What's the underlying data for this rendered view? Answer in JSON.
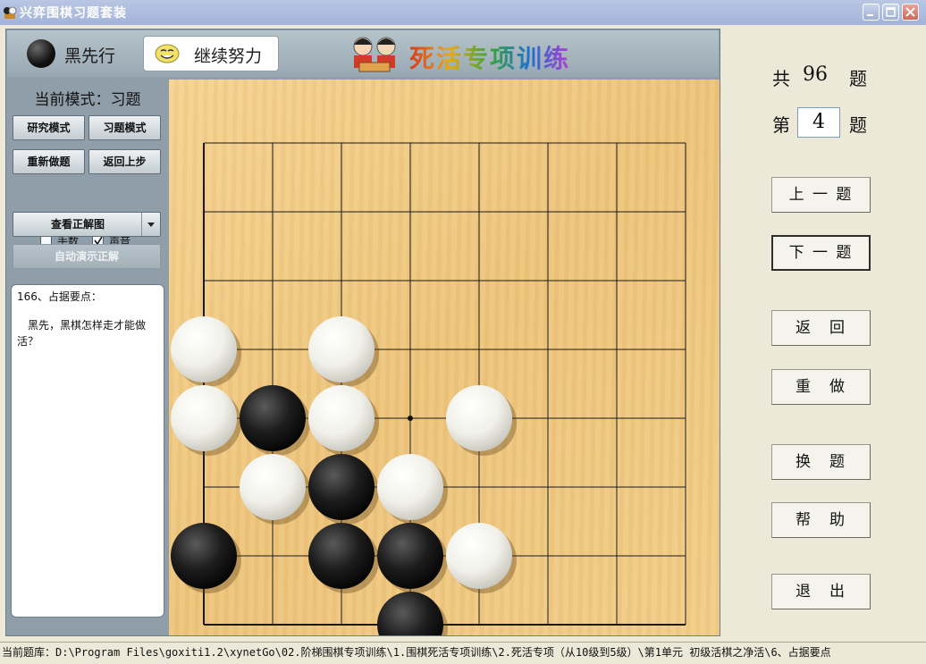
{
  "window": {
    "title": "兴弈围棋习题套装"
  },
  "header": {
    "turn_label": "黑先行",
    "message": "继续努力",
    "banner_title": "死活专项训练"
  },
  "sidebar": {
    "mode_label": "当前模式：习题",
    "buttons": {
      "study_mode": "研究模式",
      "exercise_mode": "习题模式",
      "redo": "重新做题",
      "undo": "返回上步"
    },
    "checkboxes": {
      "move_numbers": {
        "label": "手数",
        "checked": false
      },
      "sound": {
        "label": "声音",
        "checked": true
      }
    },
    "view_solution": "查看正解图",
    "auto_demo": "自动演示正解",
    "problem_title": "166、占据要点：",
    "problem_desc": "黑先，黑棋怎样走才能做活？"
  },
  "board": {
    "columns": 8,
    "rows": 8,
    "star_point": [
      3,
      4
    ],
    "stones": [
      {
        "color": "white",
        "col": 0,
        "row": 3
      },
      {
        "color": "white",
        "col": 2,
        "row": 3
      },
      {
        "color": "white",
        "col": 0,
        "row": 4
      },
      {
        "color": "black",
        "col": 1,
        "row": 4
      },
      {
        "color": "white",
        "col": 2,
        "row": 4
      },
      {
        "color": "white",
        "col": 4,
        "row": 4
      },
      {
        "color": "white",
        "col": 1,
        "row": 5
      },
      {
        "color": "black",
        "col": 2,
        "row": 5
      },
      {
        "color": "white",
        "col": 3,
        "row": 5
      },
      {
        "color": "black",
        "col": 0,
        "row": 6
      },
      {
        "color": "black",
        "col": 2,
        "row": 6
      },
      {
        "color": "black",
        "col": 3,
        "row": 6
      },
      {
        "color": "white",
        "col": 4,
        "row": 6
      },
      {
        "color": "black",
        "col": 3,
        "row": 7
      }
    ]
  },
  "right": {
    "total_prefix": "共",
    "total": "96",
    "total_suffix": "题",
    "current_prefix": "第",
    "current": "4",
    "current_suffix": "题",
    "buttons": {
      "prev": "上 一 题",
      "next": "下 一 题",
      "back": "返　回",
      "redo": "重　做",
      "change": "换　题",
      "help": "帮　助",
      "exit": "退　出"
    }
  },
  "status": {
    "text": "当前题库：D:\\Program Files\\goxiti1.2\\xynetGo\\02.阶梯围棋专项训练\\1.围棋死活专项训练\\2.死活专项（从10级到5级）\\第1单元 初级活棋之净活\\6、占据要点"
  },
  "colors": {
    "board": "#edc47a",
    "panel": "#8f9ea8",
    "titlebar": "#a3b3d9"
  }
}
